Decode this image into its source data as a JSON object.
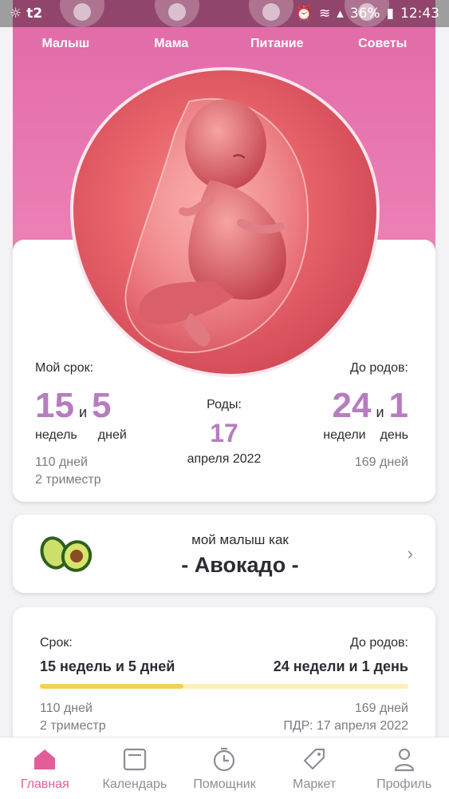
{
  "status_bar": {
    "carrier": "t2",
    "battery": "36%",
    "time": "12:43"
  },
  "tabs": [
    {
      "label": "Малыш"
    },
    {
      "label": "Мама"
    },
    {
      "label": "Питание"
    },
    {
      "label": "Советы"
    }
  ],
  "term": {
    "label": "Мой срок:",
    "weeks": "15",
    "and": "и",
    "days": "5",
    "weeks_unit": "недель",
    "days_unit": "дней",
    "total_days": "110 дней",
    "trimester": "2 триместр"
  },
  "birth": {
    "label": "Роды:",
    "day": "17",
    "month_year": "апреля 2022"
  },
  "until": {
    "label": "До родов:",
    "weeks": "24",
    "and": "и",
    "days": "1",
    "weeks_unit": "недели",
    "days_unit": "день",
    "total_days": "169 дней"
  },
  "baby_size": {
    "prefix": "мой малыш как",
    "fruit": "- Авокадо -",
    "icon": "avocado-icon"
  },
  "progress": {
    "left_label": "Срок:",
    "left_value": "15 недель и 5 дней",
    "right_label": "До родов:",
    "right_value": "24 недели и 1 день",
    "fraction": 0.39,
    "left_days": "110 дней",
    "left_trimester": "2 триместр",
    "right_days": "169 дней",
    "pdr": "ПДР: 17 апреля 2022",
    "fill_color": "#f6cf56",
    "track_color": "#fbf0b6"
  },
  "bottom_nav": [
    {
      "label": "Главная",
      "icon": "home-icon",
      "active": true
    },
    {
      "label": "Календарь",
      "icon": "calendar-icon",
      "active": false
    },
    {
      "label": "Помощник",
      "icon": "timer-icon",
      "active": false
    },
    {
      "label": "Маркет",
      "icon": "tag-icon",
      "active": false
    },
    {
      "label": "Профиль",
      "icon": "profile-icon",
      "active": false
    }
  ],
  "colors": {
    "accent": "#e35d98",
    "number": "#b77cbf",
    "hero": "#e06aa7"
  }
}
